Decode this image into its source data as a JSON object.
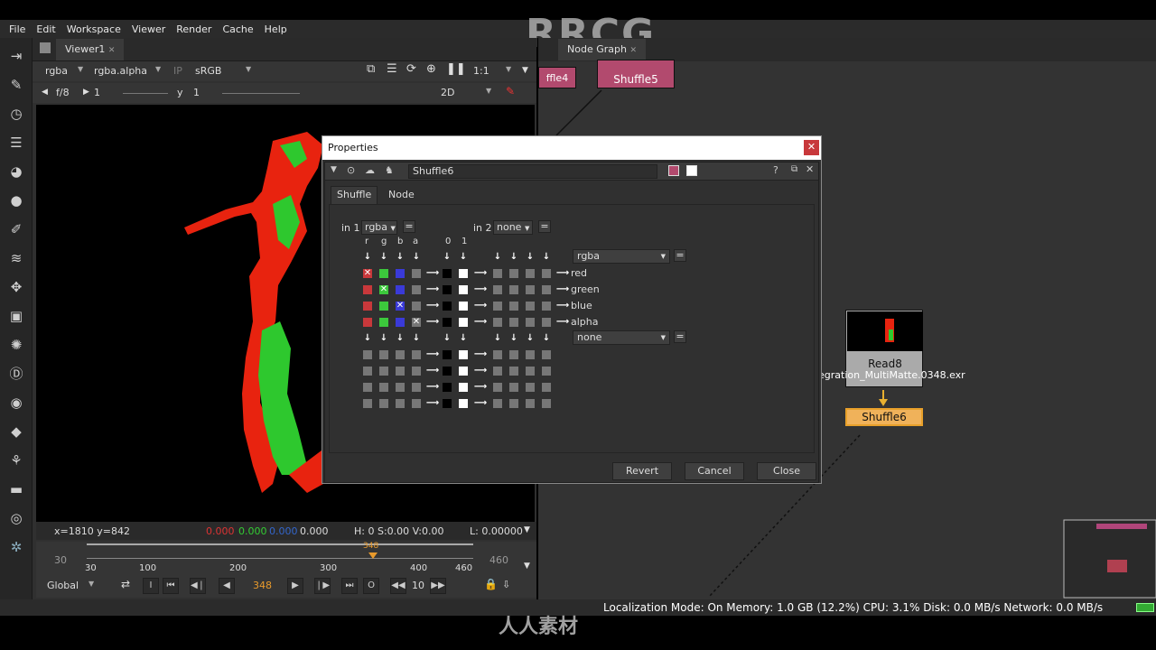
{
  "menu": [
    "File",
    "Edit",
    "Workspace",
    "Viewer",
    "Render",
    "Cache",
    "Help"
  ],
  "watermark": "RRCG",
  "viewer": {
    "tab": "Viewer1",
    "channels": "rgba",
    "alpha": "rgba.alpha",
    "ip": "IP",
    "colorspace": "sRGB",
    "zoom": "1:1",
    "fstop": "f/8",
    "gain": "1",
    "y_label": "y",
    "gamma": "1",
    "mode": "2D",
    "info": {
      "coords": "x=1810 y=842",
      "r": "0.000",
      "g": "0.000",
      "b": "0.000",
      "a": "0.000",
      "hsv": "H:  0 S:0.00 V:0.00",
      "l": "L: 0.00000"
    },
    "timeline": {
      "start": "30",
      "end": "460",
      "current": "348",
      "ticks": [
        "30",
        "100",
        "200",
        "300",
        "400",
        "460"
      ]
    },
    "transport": {
      "scope": "Global",
      "frame": "348",
      "step": "10"
    }
  },
  "nodegraph": {
    "tab": "Node Graph",
    "nodes": {
      "shuffle4": "ffle4",
      "shuffle5": "Shuffle5",
      "read8": "Read8",
      "read8_file": "egration_MultiMatte.0348.exr",
      "shuffle6": "Shuffle6"
    }
  },
  "properties": {
    "title": "Properties",
    "node_name": "Shuffle6",
    "tabs": [
      "Shuffle",
      "Node"
    ],
    "in1_label": "in 1",
    "in1": "rgba",
    "in2_label": "in 2",
    "in2": "none",
    "col_headers": [
      "r",
      "g",
      "b",
      "a",
      "0",
      "1"
    ],
    "out1": "rgba",
    "out2": "none",
    "outputs": [
      "red",
      "green",
      "blue",
      "alpha"
    ],
    "buttons": {
      "revert": "Revert",
      "cancel": "Cancel",
      "close": "Close"
    },
    "eq": "="
  },
  "status": "Localization Mode: On Memory: 1.0 GB (12.2%) CPU: 3.1% Disk: 0.0 MB/s Network: 0.0 MB/s",
  "bottom_logo": "人人素材"
}
